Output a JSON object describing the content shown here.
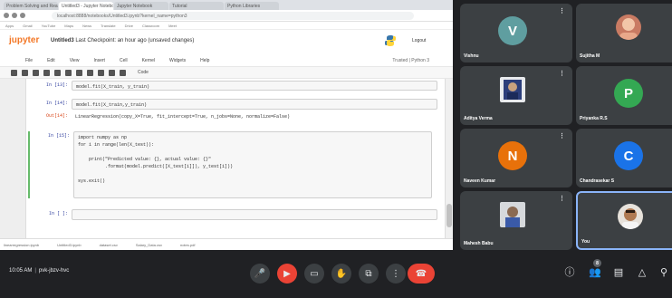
{
  "browser": {
    "tabs": [
      "Problem Solving and Reason...",
      "Untitled3 - Jupyter Notebook",
      "Jupyter Notebook",
      "Tutorial",
      "Python Libraries"
    ],
    "active_tab": 1,
    "address": "localhost:8888/notebooks/Untitled3.ipynb?kernel_name=python3",
    "bookmarks": [
      "Apps",
      "Gmail",
      "YouTube",
      "Maps",
      "News",
      "Translate",
      "Drive",
      "Classroom",
      "Meet"
    ]
  },
  "notebook": {
    "logo": "jupyter",
    "title": "Untitled3",
    "checkpoint": "Last Checkpoint: an hour ago (unsaved changes)",
    "logout_label": "Logout",
    "menu": [
      "File",
      "Edit",
      "View",
      "Insert",
      "Cell",
      "Kernel",
      "Widgets",
      "Help"
    ],
    "status": "Trusted",
    "kernel": "Python 3",
    "cell_type": "Code",
    "cells": [
      {
        "prompt": "In [13]:",
        "code": "model.fit(X_train, y_train)",
        "kind": "in"
      },
      {
        "prompt": "In [14]:",
        "code": "model.fit(X_train,y_train)",
        "kind": "in"
      },
      {
        "prompt": "Out[14]:",
        "code": "LinearRegression(copy_X=True, fit_intercept=True, n_jobs=None, normalize=False)",
        "kind": "out"
      },
      {
        "prompt": "In [15]:",
        "code": "import numpy as np\nfor i in range(len(X_test)):\n    \n    print(\"Predicted value: {}, actual value: {}\"\n          .format(model.predict([X_test[i]]), y_test[i]))\n\nsys.exit()",
        "kind": "in"
      },
      {
        "prompt": "In [ ]:",
        "code": "",
        "kind": "in"
      }
    ],
    "downloads": [
      "linearregression.ipynb",
      "Untitled3.ipynb",
      "dataset.csv",
      "Salary_Data.csv",
      "notes.pdf"
    ]
  },
  "participants": [
    {
      "name": "Vishnu",
      "initial": "V",
      "color": "#5f9ea0",
      "kind": "letter"
    },
    {
      "name": "Sujitha M",
      "initial": "",
      "color": "",
      "kind": "photo"
    },
    {
      "name": "Aditya Verma",
      "initial": "",
      "color": "",
      "kind": "photo"
    },
    {
      "name": "Priyanka R.S",
      "initial": "P",
      "color": "#34a853",
      "kind": "letter"
    },
    {
      "name": "Naveen Kumar",
      "initial": "N",
      "color": "#e8710a",
      "kind": "letter"
    },
    {
      "name": "Chandrasekar S",
      "initial": "C",
      "color": "#1a73e8",
      "kind": "letter"
    },
    {
      "name": "Mahesh Babu",
      "initial": "",
      "color": "",
      "kind": "photo"
    },
    {
      "name": "You",
      "initial": "",
      "color": "",
      "kind": "photo"
    }
  ],
  "meeting": {
    "time": "10:05 AM",
    "code": "pvk-jbzv-hvc",
    "participant_count": "8",
    "icons": {
      "mic": "mic-icon",
      "camera": "camera-icon",
      "captions": "captions-icon",
      "raise_hand": "raise-hand-icon",
      "present": "present-icon",
      "more": "more-options-icon",
      "hangup": "hang-up-icon",
      "info": "info-icon",
      "people": "people-icon",
      "chat": "chat-icon",
      "activities": "activities-icon"
    },
    "colors": {
      "background": "#202124",
      "tile": "#3c4043",
      "hangup": "#ea4335",
      "accent": "#8ab4f8"
    }
  }
}
